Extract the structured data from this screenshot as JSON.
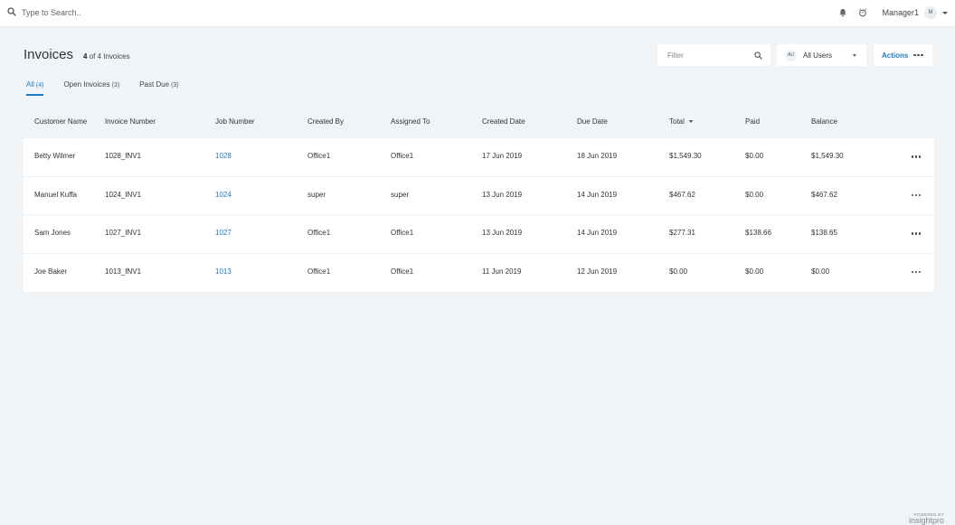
{
  "topbar": {
    "search_placeholder": "Type to Search..",
    "user_name": "Manager1",
    "avatar_initial": "M"
  },
  "page": {
    "title": "Invoices",
    "count_bold": "4",
    "count_rest": " of 4 Invoices"
  },
  "filter": {
    "placeholder": "Filter"
  },
  "users_select": {
    "badge": "AU",
    "label": "All Users"
  },
  "actions": {
    "label": "Actions"
  },
  "tabs": [
    {
      "label": "All",
      "count": "(4)",
      "active": true
    },
    {
      "label": "Open Invoices",
      "count": "(3)",
      "active": false
    },
    {
      "label": "Past Due",
      "count": "(3)",
      "active": false
    }
  ],
  "columns": [
    "Customer Name",
    "Invoice Number",
    "Job Number",
    "Created By",
    "Assigned To",
    "Created Date",
    "Due Date",
    "Total",
    "Paid",
    "Balance"
  ],
  "sort_column": "Total",
  "rows": [
    {
      "customer": "Betty Wilmer",
      "invoice": "1028_INV1",
      "job": "1028",
      "created_by": "Office1",
      "assigned_to": "Office1",
      "created_date": "17 Jun 2019",
      "due_date": "18 Jun 2019",
      "total": "$1,549.30",
      "paid": "$0.00",
      "balance": "$1,549.30"
    },
    {
      "customer": "Manuel Kuffa",
      "invoice": "1024_INV1",
      "job": "1024",
      "created_by": "super",
      "assigned_to": "super",
      "created_date": "13 Jun 2019",
      "due_date": "14 Jun 2019",
      "total": "$467.62",
      "paid": "$0.00",
      "balance": "$467.62"
    },
    {
      "customer": "Sam Jones",
      "invoice": "1027_INV1",
      "job": "1027",
      "created_by": "Office1",
      "assigned_to": "Office1",
      "created_date": "13 Jun 2019",
      "due_date": "14 Jun 2019",
      "total": "$277.31",
      "paid": "$138.66",
      "balance": "$138.65"
    },
    {
      "customer": "Joe Baker",
      "invoice": "1013_INV1",
      "job": "1013",
      "created_by": "Office1",
      "assigned_to": "Office1",
      "created_date": "11 Jun 2019",
      "due_date": "12 Jun 2019",
      "total": "$0.00",
      "paid": "$0.00",
      "balance": "$0.00"
    }
  ],
  "footer": {
    "powered_by": "POWERED BY",
    "brand": "insightpro"
  },
  "colors": {
    "accent": "#1e7bc4",
    "background": "#f0f4f7"
  },
  "icons": [
    "search-icon",
    "bell-icon",
    "alarm-clock-icon",
    "chevron-down-icon",
    "more-horizontal-icon"
  ]
}
